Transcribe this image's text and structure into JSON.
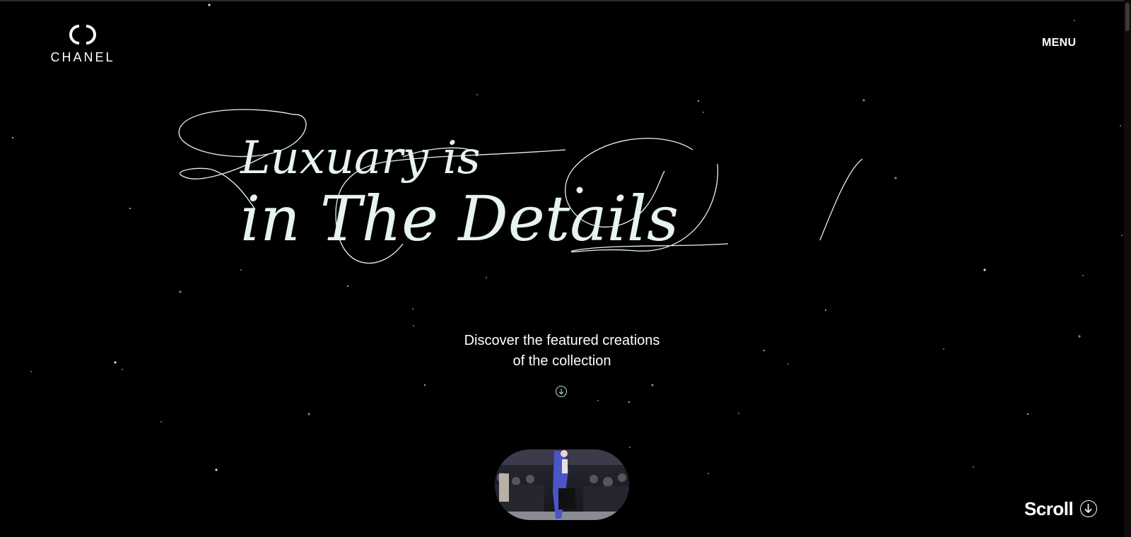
{
  "brand": {
    "name": "CHANEL",
    "logo_icon": "interlocking-cc-logo"
  },
  "nav": {
    "menu_label": "MENU"
  },
  "hero": {
    "headline_line1": "Luxuary is",
    "headline_line2": "in The Details",
    "subtitle_line1": "Discover the featured creations",
    "subtitle_line2": "of the collection",
    "discover_icon": "arrow-down-circle-icon"
  },
  "video": {
    "thumbnail": "runway-video-thumbnail"
  },
  "scroll_cta": {
    "label": "Scroll",
    "icon": "arrow-down-circle-icon"
  },
  "colors": {
    "background": "#000000",
    "text": "#ffffff",
    "headline": "#e6f3ef",
    "accent": "#bfe3da"
  }
}
